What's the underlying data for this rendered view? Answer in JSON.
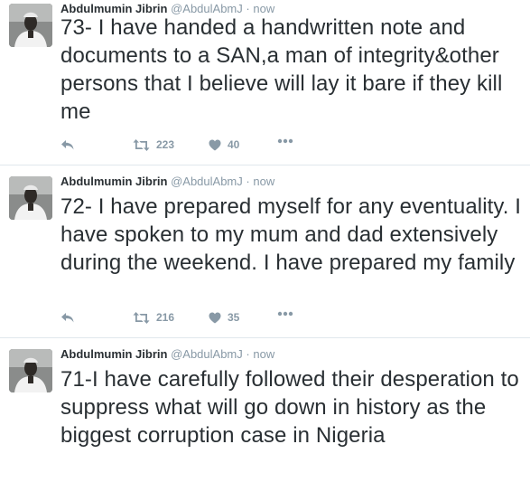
{
  "tweets": [
    {
      "author": {
        "name": "Abdulmumin Jibrin",
        "handle": "@AbdulAbmJ"
      },
      "separator": "·",
      "time": "now",
      "text": "73- I have handed a handwritten note and documents to a SAN,a man of integrity&other persons that I believe will lay it bare if they kill me",
      "retweets": "223",
      "likes": "40"
    },
    {
      "author": {
        "name": "Abdulmumin Jibrin",
        "handle": "@AbdulAbmJ"
      },
      "separator": "·",
      "time": "now",
      "text": "72- I have prepared myself for any eventuality. I have spoken to my mum and dad extensively during the weekend. I have prepared my family",
      "retweets": "216",
      "likes": "35"
    },
    {
      "author": {
        "name": "Abdulmumin Jibrin",
        "handle": "@AbdulAbmJ"
      },
      "separator": "·",
      "time": "now",
      "text": "71-I have carefully followed their desperation to suppress what will go down in history as the biggest corruption case in Nigeria"
    }
  ],
  "icons": {
    "reply": "reply-icon",
    "retweet": "retweet-icon",
    "like": "heart-icon",
    "more": "more-icon",
    "avatar": "profile-photo"
  },
  "colors": {
    "text": "#292f33",
    "muted": "#8899a6",
    "border": "#e1e8ed"
  }
}
